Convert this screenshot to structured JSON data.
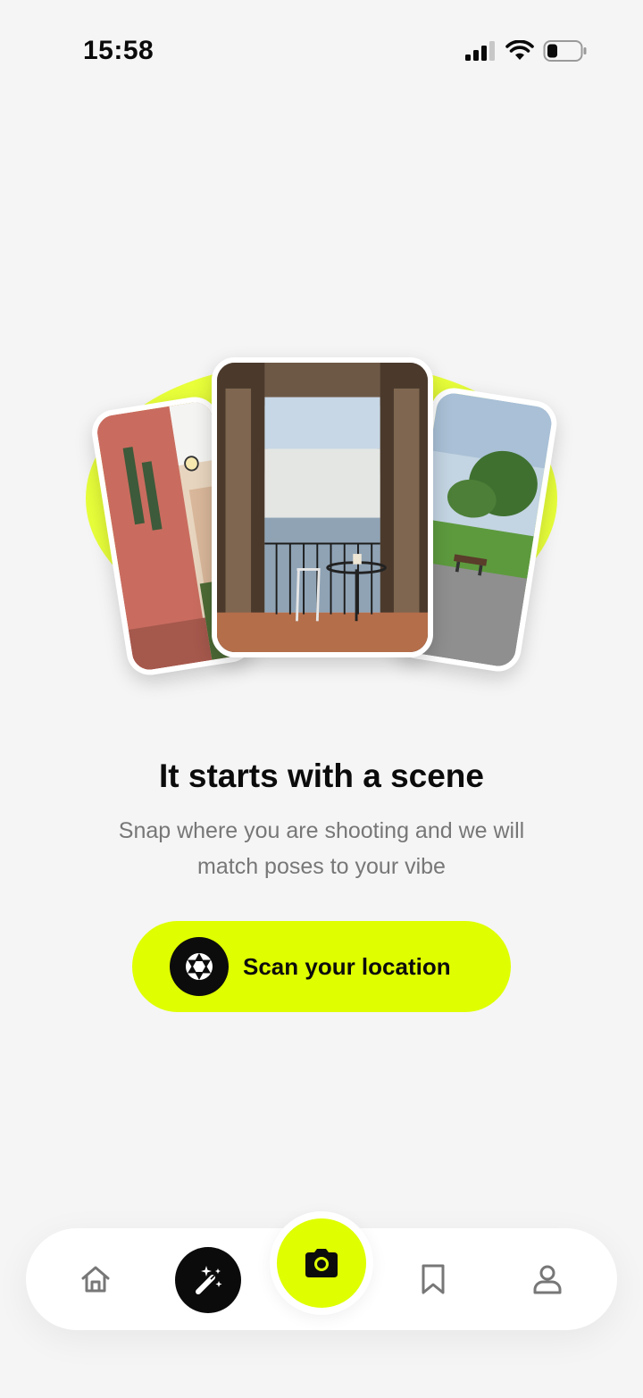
{
  "status_bar": {
    "time": "15:58",
    "icons": [
      "cellular-signal-icon",
      "wifi-icon",
      "battery-icon"
    ]
  },
  "hero": {
    "images": [
      "street-photo",
      "balcony-photo",
      "park-photo"
    ],
    "accent_color": "#e8ff3a"
  },
  "onboarding": {
    "title": "It starts with a scene",
    "subtitle_line1": "Snap where you are shooting and we will",
    "subtitle_line2": "match poses to your vibe",
    "cta_label": "Scan your location",
    "cta_icon": "aperture-icon",
    "cta_color": "#dfff00"
  },
  "nav": {
    "items": [
      {
        "name": "home",
        "icon": "home-icon"
      },
      {
        "name": "magic",
        "icon": "magic-wand-icon"
      },
      {
        "name": "camera",
        "icon": "camera-icon"
      },
      {
        "name": "saved",
        "icon": "bookmark-icon"
      },
      {
        "name": "profile",
        "icon": "person-icon"
      }
    ]
  }
}
